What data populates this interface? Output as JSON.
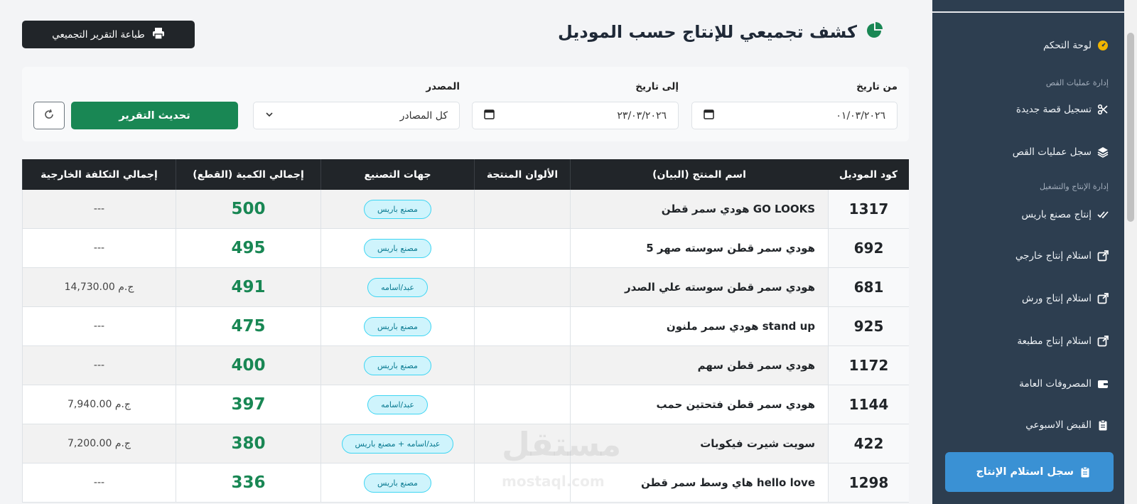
{
  "sidebar": {
    "dashboard": "لوحة التحكم",
    "section_cutting": "إدارة عمليات القص",
    "new_cut": "تسجيل قصة جديدة",
    "cut_log": "سجل عمليات القص",
    "section_production": "إدارة الإنتاج والتشغيل",
    "paris_production": "إنتاج مصنع باريس",
    "external_receipt": "استلام إنتاج خارجي",
    "workshop_receipt": "استلام إنتاج ورش",
    "print_receipt": "استلام إنتاج مطبعة",
    "general_expenses": "المصروفات العامة",
    "weekly_pay": "القبض الاسبوعي",
    "receipt_log": "سجل استلام الإنتاج"
  },
  "header": {
    "title": "كشف تجميعي للإنتاج حسب الموديل",
    "print_label": "طباعة التقرير التجميعي"
  },
  "filters": {
    "from_label": "من تاريخ",
    "from_value": "٠١/٠٣/٢٠٢٦",
    "to_label": "إلى تاريخ",
    "to_value": "٢٣/٠٣/٢٠٢٦",
    "source_label": "المصدر",
    "source_value": "كل المصادر",
    "update_label": "تحديث التقرير"
  },
  "table": {
    "headers": {
      "code": "كود الموديل",
      "name": "اسم المنتج (البيان)",
      "colors": "الألوان المنتجة",
      "factories": "جهات التصنيع",
      "qty": "إجمالي الكمية (القطع)",
      "cost": "إجمالي التكلفة الخارجية"
    },
    "rows": [
      {
        "code": "1317",
        "name": "هودي سمر قطن GO LOOKS",
        "colors": "",
        "factory": "مصنع باريس",
        "qty": "500",
        "cost": "---"
      },
      {
        "code": "692",
        "name": "هودي سمر قطن سوسته صهر 5",
        "colors": "",
        "factory": "مصنع باريس",
        "qty": "495",
        "cost": "---"
      },
      {
        "code": "681",
        "name": "هودي سمر قطن سوسته علي الصدر",
        "colors": "",
        "factory": "عبد/اسامه",
        "qty": "491",
        "cost": "14,730.00 ج.م"
      },
      {
        "code": "925",
        "name": "هودي سمر ملنون stand up",
        "colors": "",
        "factory": "مصنع باريس",
        "qty": "475",
        "cost": "---"
      },
      {
        "code": "1172",
        "name": "هودي سمر قطن سهم",
        "colors": "",
        "factory": "مصنع باريس",
        "qty": "400",
        "cost": "---"
      },
      {
        "code": "1144",
        "name": "هودي سمر قطن فتحتين حمب",
        "colors": "",
        "factory": "عبد/اسامه",
        "qty": "397",
        "cost": "7,940.00 ج.م"
      },
      {
        "code": "422",
        "name": "سويت شيرت فيكوبات",
        "colors": "",
        "factory": "عبد/اسامه + مصنع باريس",
        "qty": "380",
        "cost": "7,200.00 ج.م"
      },
      {
        "code": "1298",
        "name": "هاي وسط سمر قطن hello love",
        "colors": "",
        "factory": "مصنع باريس",
        "qty": "336",
        "cost": "---"
      }
    ]
  },
  "watermark": {
    "main": "مستقل",
    "sub": "mostaql.com"
  },
  "colors": {
    "sidebar_bg": "#2d3e50",
    "active_item": "#3a91d4",
    "primary_green": "#198754",
    "table_header": "#212529"
  },
  "icons": [
    "chart-pie-icon",
    "printer-icon",
    "calendar-icon",
    "chevron-down-icon",
    "refresh-icon",
    "gauge-icon",
    "scissors-icon",
    "layers-icon",
    "double-check-icon",
    "external-link-icon",
    "wallet-icon",
    "clipboard-icon"
  ]
}
